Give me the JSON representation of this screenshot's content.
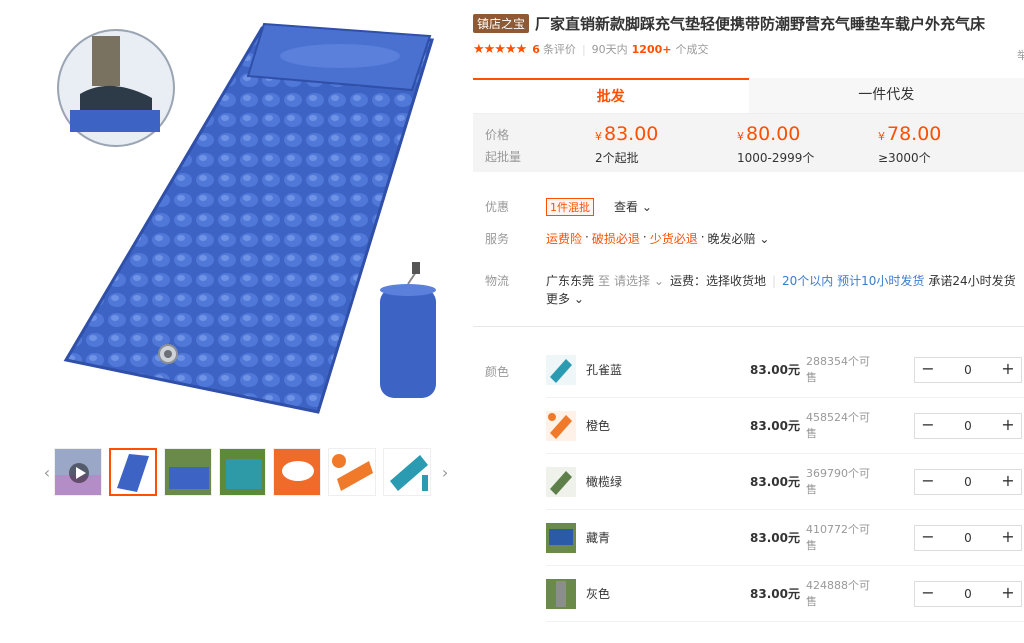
{
  "product": {
    "shop_badge": "镇店之宝",
    "title": "厂家直销新款脚踩充气垫轻便携带防潮野营充气睡垫车载户外充气床",
    "rating_count": "6",
    "rating_label": "条评价",
    "period": "90天内",
    "sold_count": "1200+",
    "sold_label": "个成交",
    "right_cut_text": "举"
  },
  "tabs": [
    {
      "label": "批发",
      "active": true
    },
    {
      "label": "一件代发",
      "active": false
    }
  ],
  "price_box": {
    "price_label": "价格",
    "min_label": "起批量",
    "yen": "¥",
    "tiers": [
      {
        "price": "83.00",
        "qty": "2个起批"
      },
      {
        "price": "80.00",
        "qty": "1000-2999个"
      },
      {
        "price": "78.00",
        "qty": "≥3000个"
      }
    ]
  },
  "attributes": {
    "promo": {
      "label": "优惠",
      "tag": "1件混批",
      "link": "查看"
    },
    "service": {
      "label": "服务",
      "items": [
        "运费险",
        "破损必退",
        "少货必退"
      ],
      "extra": "晚发必赔"
    },
    "logistics": {
      "label": "物流",
      "from": "广东东莞",
      "to_word": "至",
      "select": "请选择",
      "freight": "运费：选择收货地",
      "promise_blue": "20个以内 预计10小时发货",
      "promise": "承诺24小时发货",
      "more": "更多"
    }
  },
  "sku": {
    "label": "颜色",
    "currency_suffix": "元",
    "items": [
      {
        "name": "孔雀蓝",
        "price": "83.00元",
        "stock_a": "288354个可",
        "stock_b": "售",
        "qty": "0",
        "color": "#2a9bb0"
      },
      {
        "name": "橙色",
        "price": "83.00元",
        "stock_a": "458524个可",
        "stock_b": "售",
        "qty": "0",
        "color": "#f07a2a"
      },
      {
        "name": "橄榄绿",
        "price": "83.00元",
        "stock_a": "369790个可",
        "stock_b": "售",
        "qty": "0",
        "color": "#5f7f4a"
      },
      {
        "name": "藏青",
        "price": "83.00元",
        "stock_a": "410772个可",
        "stock_b": "售",
        "qty": "0",
        "color": "#2a5aa8"
      },
      {
        "name": "灰色",
        "price": "83.00元",
        "stock_a": "424888个可",
        "stock_b": "售",
        "qty": "0",
        "color": "#8a8f88"
      }
    ]
  },
  "stepper": {
    "minus": "−",
    "plus": "+"
  },
  "colors": {
    "accent": "#ff5000",
    "mat_blue": "#3d63c4",
    "badge": "#8d5a35"
  }
}
